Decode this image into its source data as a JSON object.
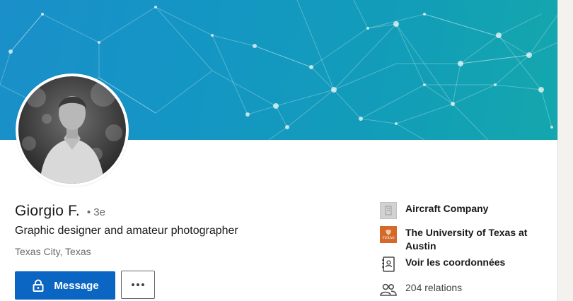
{
  "profile": {
    "name": "Giorgio F.",
    "degree": "• 3e",
    "headline": "Graphic designer and amateur photographer",
    "location": "Texas City, Texas"
  },
  "actions": {
    "message_label": "Message",
    "more_icon": "more-horizontal-icon"
  },
  "sidebar": {
    "company": "Aircraft Company",
    "education": "The University of Texas at Austin",
    "education_logo_text": "TEXAS",
    "contact": "Voir les coordonnées",
    "connections": "204 relations"
  },
  "colors": {
    "primary": "#0a66c2",
    "banner_start": "#1a8fc9",
    "banner_end": "#14a7ad",
    "ut_orange": "#d4692a"
  }
}
